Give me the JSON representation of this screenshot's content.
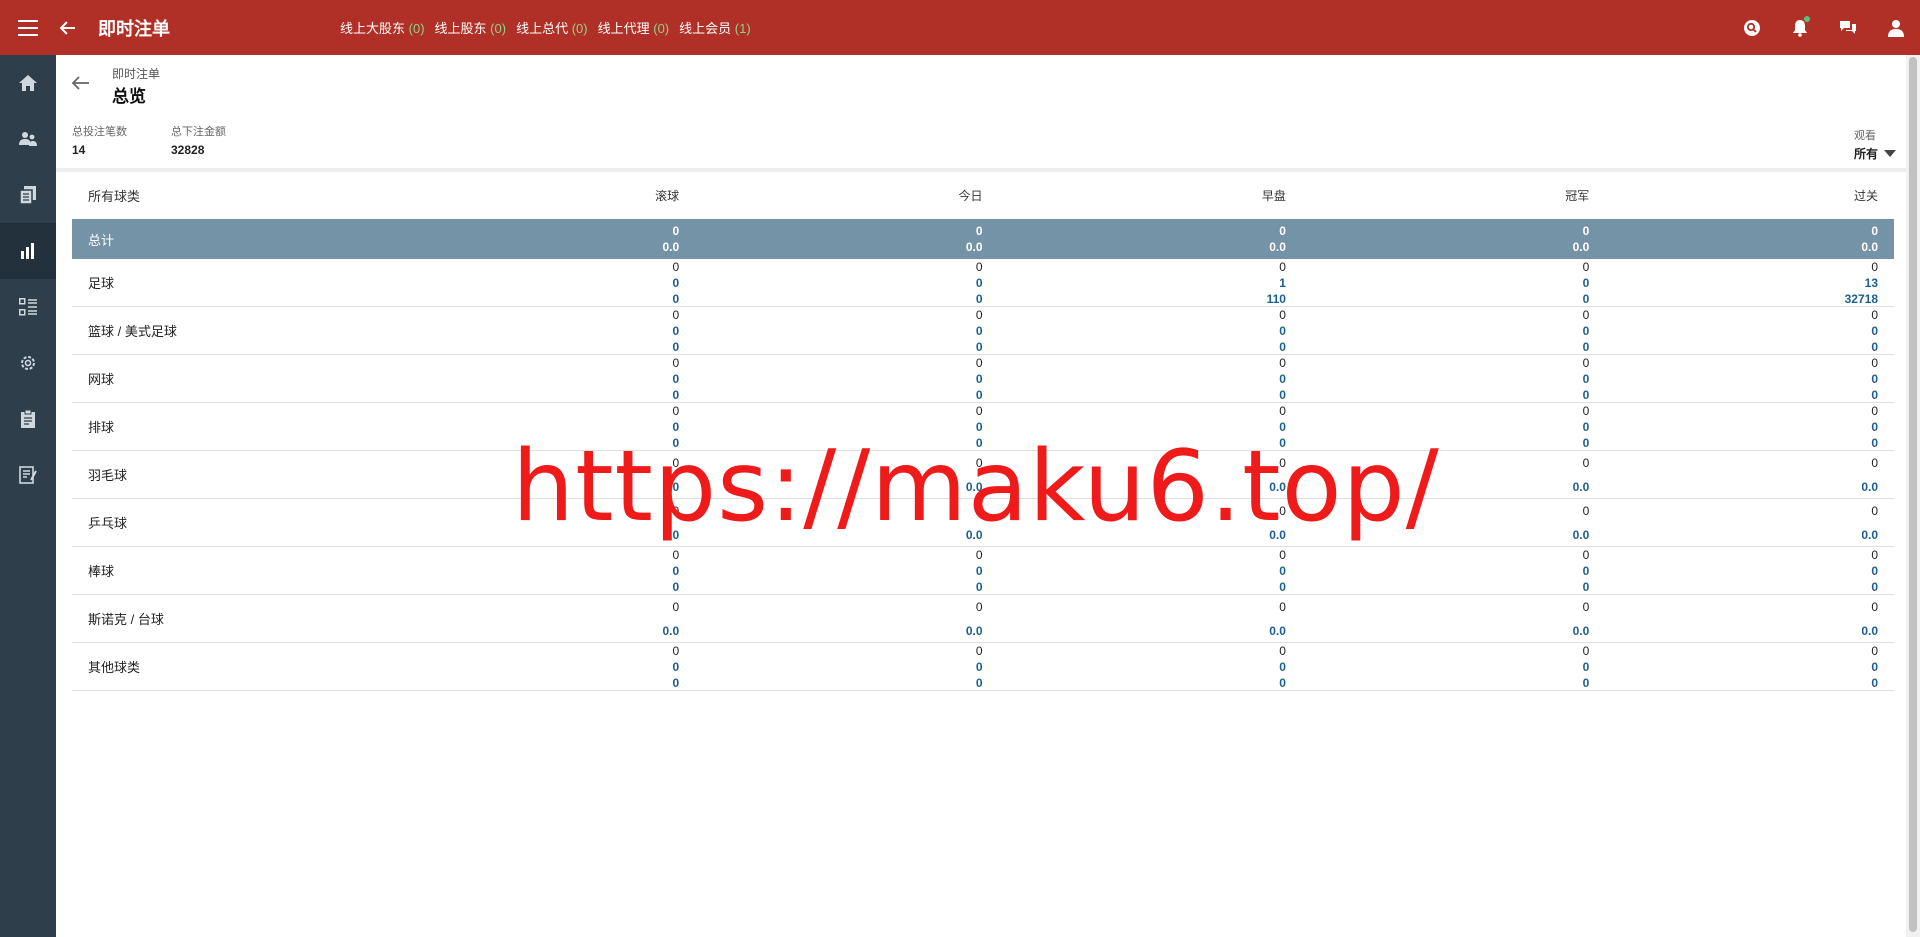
{
  "topbar": {
    "title": "即时注单",
    "online": [
      {
        "label": "线上大股东",
        "count": "(0)"
      },
      {
        "label": "线上股东",
        "count": "(0)"
      },
      {
        "label": "线上总代",
        "count": "(0)"
      },
      {
        "label": "线上代理",
        "count": "(0)"
      },
      {
        "label": "线上会员",
        "count": "(1)"
      }
    ],
    "icons": [
      "search-icon",
      "bell-icon",
      "chat-icon",
      "user-icon"
    ]
  },
  "sidebar": {
    "items": [
      "home-icon",
      "users-icon",
      "documents-icon",
      "chart-icon",
      "list-icon",
      "settings-icon",
      "clipboard-icon",
      "report-icon"
    ],
    "active_index": 3
  },
  "page": {
    "breadcrumb": "即时注单",
    "title": "总览",
    "stats": [
      {
        "label": "总投注笔数",
        "value": "14"
      },
      {
        "label": "总下注金额",
        "value": "32828"
      }
    ],
    "view": {
      "label": "观看",
      "value": "所有"
    }
  },
  "table": {
    "headers": [
      "所有球类",
      "滚球",
      "今日",
      "早盘",
      "冠军",
      "过关"
    ],
    "total": {
      "label": "总计",
      "cells": [
        [
          "0",
          "0.0"
        ],
        [
          "0",
          "0.0"
        ],
        [
          "0",
          "0.0"
        ],
        [
          "0",
          "0.0"
        ],
        [
          "0",
          "0.0"
        ]
      ]
    },
    "rows": [
      {
        "label": "足球",
        "cells": [
          [
            "0",
            "0",
            "0"
          ],
          [
            "0",
            "0",
            "0"
          ],
          [
            "0",
            "1",
            "110"
          ],
          [
            "0",
            "0",
            "0"
          ],
          [
            "0",
            "13",
            "32718"
          ]
        ]
      },
      {
        "label": "篮球 / 美式足球",
        "cells": [
          [
            "0",
            "0",
            "0"
          ],
          [
            "0",
            "0",
            "0"
          ],
          [
            "0",
            "0",
            "0"
          ],
          [
            "0",
            "0",
            "0"
          ],
          [
            "0",
            "0",
            "0"
          ]
        ]
      },
      {
        "label": "网球",
        "cells": [
          [
            "0",
            "0",
            "0"
          ],
          [
            "0",
            "0",
            "0"
          ],
          [
            "0",
            "0",
            "0"
          ],
          [
            "0",
            "0",
            "0"
          ],
          [
            "0",
            "0",
            "0"
          ]
        ]
      },
      {
        "label": "排球",
        "cells": [
          [
            "0",
            "0",
            "0"
          ],
          [
            "0",
            "0",
            "0"
          ],
          [
            "0",
            "0",
            "0"
          ],
          [
            "0",
            "0",
            "0"
          ],
          [
            "0",
            "0",
            "0"
          ]
        ]
      },
      {
        "label": "羽毛球",
        "cells": [
          [
            "0",
            "0.0"
          ],
          [
            "0",
            "0.0"
          ],
          [
            "0",
            "0.0"
          ],
          [
            "0",
            "0.0"
          ],
          [
            "0",
            "0.0"
          ]
        ]
      },
      {
        "label": "乒乓球",
        "cells": [
          [
            "0",
            "0.0"
          ],
          [
            "0",
            "0.0"
          ],
          [
            "0",
            "0.0"
          ],
          [
            "0",
            "0.0"
          ],
          [
            "0",
            "0.0"
          ]
        ]
      },
      {
        "label": "棒球",
        "cells": [
          [
            "0",
            "0",
            "0"
          ],
          [
            "0",
            "0",
            "0"
          ],
          [
            "0",
            "0",
            "0"
          ],
          [
            "0",
            "0",
            "0"
          ],
          [
            "0",
            "0",
            "0"
          ]
        ]
      },
      {
        "label": "斯诺克 / 台球",
        "cells": [
          [
            "0",
            "0.0"
          ],
          [
            "0",
            "0.0"
          ],
          [
            "0",
            "0.0"
          ],
          [
            "0",
            "0.0"
          ],
          [
            "0",
            "0.0"
          ]
        ]
      },
      {
        "label": "其他球类",
        "cells": [
          [
            "0",
            "0",
            "0"
          ],
          [
            "0",
            "0",
            "0"
          ],
          [
            "0",
            "0",
            "0"
          ],
          [
            "0",
            "0",
            "0"
          ],
          [
            "0",
            "0",
            "0"
          ]
        ]
      }
    ]
  },
  "watermark": "https://maku6.top/"
}
